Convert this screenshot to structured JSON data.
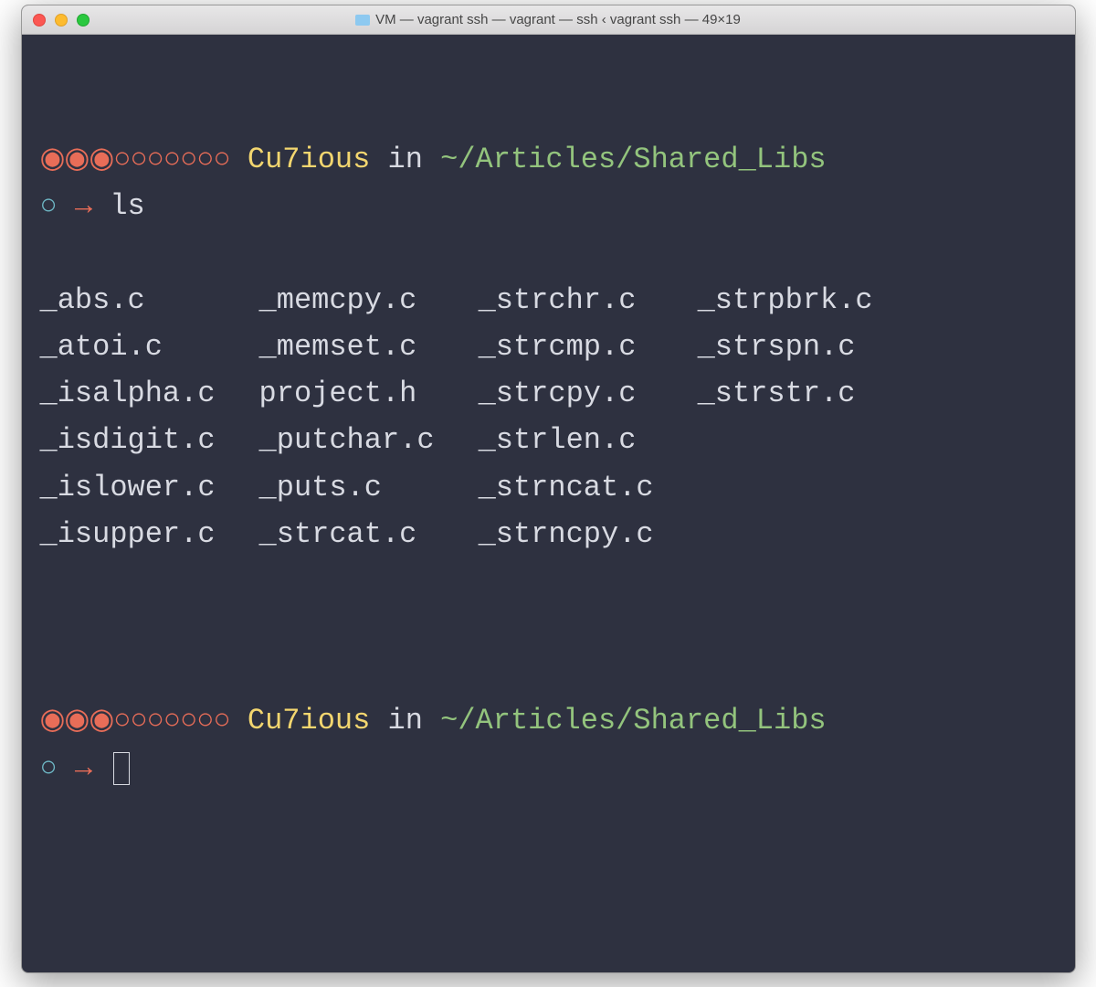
{
  "window": {
    "title": "VM — vagrant ssh — vagrant — ssh ‹ vagrant ssh — 49×19"
  },
  "prompt": {
    "bullets": "◉◉◉○○○○○○○",
    "user": "Cu7ious",
    "in": "in",
    "path": "~/Articles/Shared_Libs",
    "status": "○",
    "arrow": "→"
  },
  "command": "ls",
  "files": [
    "_abs.c",
    "_memcpy.c",
    "_strchr.c",
    "_strpbrk.c",
    "_atoi.c",
    "_memset.c",
    "_strcmp.c",
    "_strspn.c",
    "_isalpha.c",
    "project.h",
    "_strcpy.c",
    "_strstr.c",
    "_isdigit.c",
    "_putchar.c",
    "_strlen.c",
    "",
    "_islower.c",
    "_puts.c",
    "_strncat.c",
    "",
    "_isupper.c",
    "_strcat.c",
    "_strncpy.c",
    ""
  ]
}
